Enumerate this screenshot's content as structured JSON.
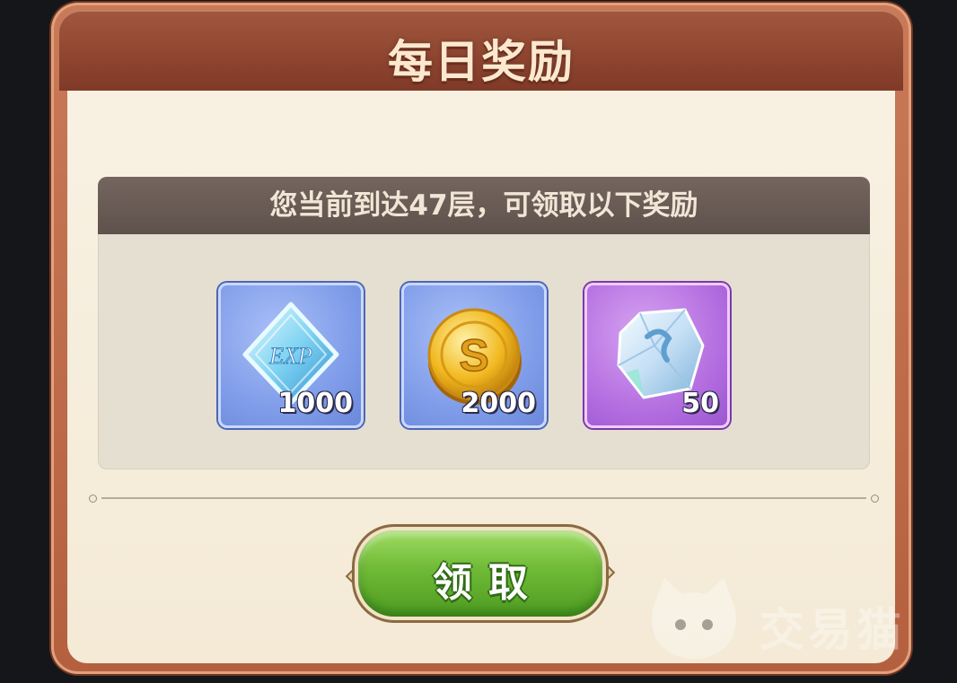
{
  "dialog": {
    "title": "每日奖励",
    "reward_header": "您当前到达47层，可领取以下奖励",
    "rewards": [
      {
        "icon": "exp-crystal-icon",
        "count": "1000"
      },
      {
        "icon": "gold-coin-icon",
        "count": "2000"
      },
      {
        "icon": "ice-gem-icon",
        "count": "50"
      }
    ],
    "claim_label": "领取"
  },
  "watermark": {
    "text": "交易猫"
  },
  "colors": {
    "frame": "#b4603f",
    "title_bar": "#8e4530",
    "body_bg": "#f6eedd",
    "header_bg": "#6a5b55",
    "button_green": "#6fba36",
    "tile_blue": "#7f9ce9",
    "tile_purple": "#b46ee0"
  }
}
